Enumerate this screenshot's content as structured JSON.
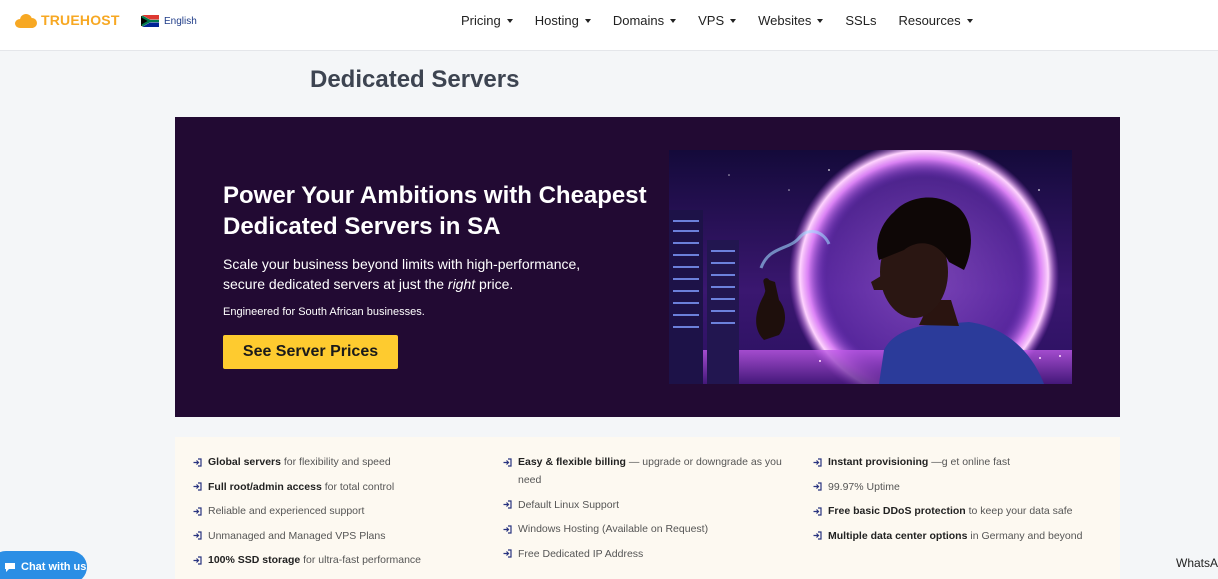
{
  "brand": {
    "name": "TRUEHOST",
    "color": "#f7a823"
  },
  "language": {
    "label": "English",
    "flag": "south-africa-flag"
  },
  "nav": [
    {
      "label": "Pricing",
      "dropdown": true
    },
    {
      "label": "Hosting",
      "dropdown": true
    },
    {
      "label": "Domains",
      "dropdown": true
    },
    {
      "label": "VPS",
      "dropdown": true
    },
    {
      "label": "Websites",
      "dropdown": true
    },
    {
      "label": "SSLs",
      "dropdown": false
    },
    {
      "label": "Resources",
      "dropdown": true
    }
  ],
  "page_title": "Dedicated Servers",
  "hero": {
    "heading": "Power Your Ambitions with Cheapest Dedicated Servers in SA",
    "sub_before": "Scale your business beyond limits with high-performance, secure dedicated servers at just the ",
    "sub_em": "right",
    "sub_after": " price.",
    "note": "Engineered for South African businesses.",
    "cta_label": "See Server Prices",
    "cta_color": "#fecb2f",
    "background": "#220a33"
  },
  "features": {
    "col1": [
      {
        "bold": "Global servers",
        "text": " for flexibility and speed"
      },
      {
        "bold": "Full root/admin access",
        "text": " for total control"
      },
      {
        "bold": "",
        "text": "Reliable and experienced support"
      },
      {
        "bold": "",
        "text": "Unmanaged and Managed VPS Plans"
      },
      {
        "bold": "100% SSD storage",
        "text": " for ultra-fast performance"
      }
    ],
    "col2": [
      {
        "bold": "Easy & flexible billing",
        "text": " — upgrade or downgrade as you need"
      },
      {
        "bold": "",
        "text": "Default Linux Support"
      },
      {
        "bold": "",
        "text": "Windows Hosting (Available on Request)"
      },
      {
        "bold": "",
        "text": "Free Dedicated IP Address"
      }
    ],
    "col3": [
      {
        "bold": "Instant provisioning",
        "text": " —g et online fast"
      },
      {
        "bold": "",
        "text": "99.97% Uptime"
      },
      {
        "bold": "Free basic DDoS protection",
        "text": " to keep your data safe"
      },
      {
        "bold": "Multiple data center options",
        "text": " in Germany and beyond"
      }
    ]
  },
  "chat_widget": {
    "label": "Chat with us",
    "color": "#2b8ee5"
  },
  "whatsapp_label": "WhatsA"
}
